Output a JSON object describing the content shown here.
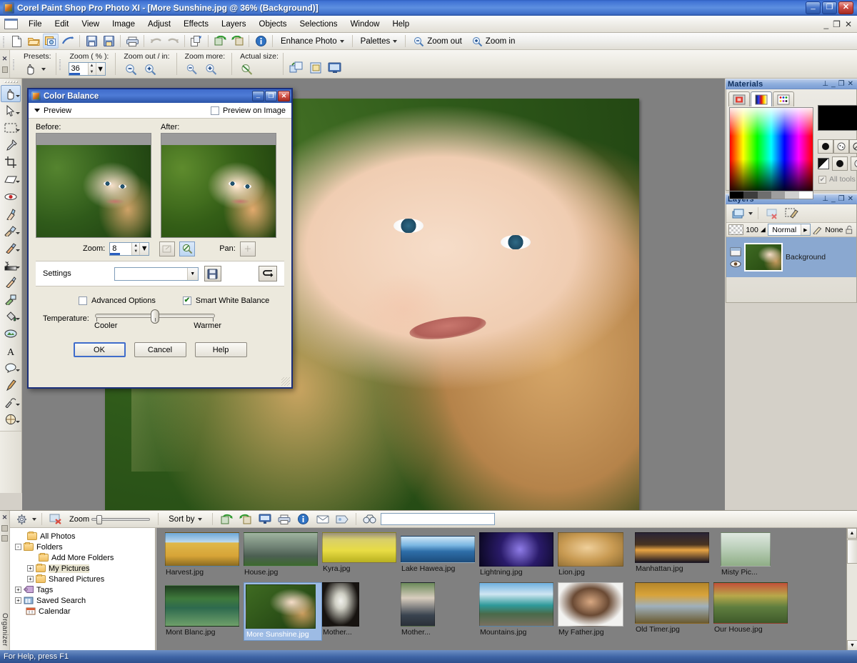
{
  "window": {
    "title": "Corel Paint Shop Pro Photo XI - [More Sunshine.jpg @  36% (Background)]",
    "minimize": "_",
    "restore": "❐",
    "close": "✕",
    "doc_minimize": "_",
    "doc_restore": "❐",
    "doc_close": "✕"
  },
  "menubar": {
    "items": [
      {
        "label": "File"
      },
      {
        "label": "Edit"
      },
      {
        "label": "View"
      },
      {
        "label": "Image"
      },
      {
        "label": "Adjust"
      },
      {
        "label": "Effects"
      },
      {
        "label": "Layers"
      },
      {
        "label": "Objects"
      },
      {
        "label": "Selections"
      },
      {
        "label": "Window"
      },
      {
        "label": "Help"
      }
    ]
  },
  "toolbar": {
    "enhance_photo": "Enhance Photo",
    "palettes": "Palettes",
    "zoom_out": "Zoom out",
    "zoom_in": "Zoom in",
    "icons": [
      "new-icon",
      "open-icon",
      "browse-icon",
      "save-as-shortcut-icon",
      "save-icon",
      "save-copy-icon",
      "print-icon",
      "undo-icon",
      "redo-icon",
      "duplicate-icon",
      "rotate-left-icon",
      "rotate-right-icon",
      "info-icon"
    ]
  },
  "tool_options": {
    "presets_label": "Presets:",
    "zoom_label": "Zoom ( % ):",
    "zoom_value": "36",
    "zoom_outin_label": "Zoom out / in:",
    "zoom_more_label": "Zoom more:",
    "actual_size_label": "Actual size:"
  },
  "tools": {
    "items": [
      {
        "name": "pan-tool",
        "selected": true,
        "arrow": true
      },
      {
        "name": "pick-tool",
        "selected": false,
        "arrow": true
      },
      {
        "name": "selection-tool",
        "selected": false,
        "arrow": true
      },
      {
        "name": "dropper-tool",
        "selected": false,
        "arrow": false
      },
      {
        "name": "crop-tool",
        "selected": false,
        "arrow": false
      },
      {
        "name": "straighten-tool",
        "selected": false,
        "arrow": true
      },
      {
        "name": "red-eye-tool",
        "selected": false,
        "arrow": false
      },
      {
        "name": "makeover-tool",
        "selected": false,
        "arrow": false
      },
      {
        "name": "clone-brush-tool",
        "selected": false,
        "arrow": true
      },
      {
        "name": "scratch-remover-tool",
        "selected": false,
        "arrow": true
      },
      {
        "name": "dodge-burn-tool",
        "selected": false,
        "arrow": true
      },
      {
        "name": "paint-brush-tool",
        "selected": false,
        "arrow": false
      },
      {
        "name": "airbrush-tool",
        "selected": false,
        "arrow": false
      },
      {
        "name": "flood-fill-tool",
        "selected": false,
        "arrow": true
      },
      {
        "name": "picture-tube-tool",
        "selected": false,
        "arrow": false
      },
      {
        "name": "text-tool",
        "selected": false,
        "arrow": false
      },
      {
        "name": "preset-shape-tool",
        "selected": false,
        "arrow": true
      },
      {
        "name": "pen-tool",
        "selected": false,
        "arrow": false
      },
      {
        "name": "warp-brush-tool",
        "selected": false,
        "arrow": true
      },
      {
        "name": "mesh-warp-tool",
        "selected": false,
        "arrow": true
      }
    ]
  },
  "materials": {
    "title": "Materials",
    "pin": "⊥",
    "minimize": "_",
    "maximize": "❐",
    "close": "✕",
    "tabs": [
      "frame-tab",
      "rainbow-tab",
      "swatches-tab"
    ],
    "all_tools_label": "All tools",
    "foreground_color": "#000000",
    "background_color": "#ffffff"
  },
  "layers": {
    "title": "Layers",
    "pin": "⊥",
    "minimize": "_",
    "maximize": "❐",
    "close": "✕",
    "opacity": "100",
    "blend_mode": "Normal",
    "mask_label": "None",
    "rows": [
      {
        "name": "Background"
      }
    ]
  },
  "organizer": {
    "tab_label": "Organizer",
    "zoom_label": "Zoom",
    "sort_by_label": "Sort by",
    "search_value": "",
    "tree": [
      {
        "label": "All Photos",
        "depth": 1,
        "expander": "",
        "icon": "folder-icon",
        "selected": false
      },
      {
        "label": "Folders",
        "depth": 0,
        "expander": "-",
        "icon": "folder-icon",
        "selected": false
      },
      {
        "label": "Add More Folders",
        "depth": 2,
        "expander": "",
        "icon": "add-folder-icon",
        "selected": false
      },
      {
        "label": "My Pictures",
        "depth": 1,
        "expander": "+",
        "icon": "folder-icon",
        "selected": true
      },
      {
        "label": "Shared Pictures",
        "depth": 1,
        "expander": "+",
        "icon": "folder-icon",
        "selected": false
      },
      {
        "label": "Tags",
        "depth": 0,
        "expander": "+",
        "icon": "tag-icon",
        "selected": false
      },
      {
        "label": "Saved Search",
        "depth": 0,
        "expander": "+",
        "icon": "saved-search-icon",
        "selected": false
      },
      {
        "label": "Calendar",
        "depth": 0,
        "expander": "",
        "icon": "calendar-icon",
        "selected": false
      }
    ],
    "thumbnails": [
      {
        "caption": "Harvest.jpg",
        "selected": false
      },
      {
        "caption": "House.jpg",
        "selected": false
      },
      {
        "caption": "Kyra.jpg",
        "selected": false
      },
      {
        "caption": "Lake Hawea.jpg",
        "selected": false
      },
      {
        "caption": "Lightning.jpg",
        "selected": false
      },
      {
        "caption": "Lion.jpg",
        "selected": false
      },
      {
        "caption": "Manhattan.jpg",
        "selected": false
      },
      {
        "caption": "Misty Pic...",
        "selected": false
      },
      {
        "caption": "Mont Blanc.jpg",
        "selected": false
      },
      {
        "caption": "More Sunshine.jpg",
        "selected": true
      },
      {
        "caption": "Mother...",
        "selected": false
      },
      {
        "caption": "Mother...",
        "selected": false
      },
      {
        "caption": "Mountains.jpg",
        "selected": false
      },
      {
        "caption": "My Father.jpg",
        "selected": false
      },
      {
        "caption": "Old Timer.jpg",
        "selected": false
      },
      {
        "caption": "Our House.jpg",
        "selected": false
      }
    ]
  },
  "dialog": {
    "title": "Color Balance",
    "minimize": "_",
    "maximize": "❐",
    "close": "✕",
    "preview_label": "Preview",
    "preview_on_image_label": "Preview on Image",
    "preview_on_image_checked": false,
    "before_label": "Before:",
    "after_label": "After:",
    "zoom_label": "Zoom:",
    "zoom_value": "8",
    "pan_label": "Pan:",
    "settings_label": "Settings",
    "settings_value": "",
    "advanced_options_label": "Advanced Options",
    "advanced_options_checked": false,
    "smart_white_balance_label": "Smart White Balance",
    "smart_white_balance_checked": true,
    "smart_white_balance_check": "✔",
    "temperature_label": "Temperature:",
    "cooler_label": "Cooler",
    "warmer_label": "Warmer",
    "ok_label": "OK",
    "cancel_label": "Cancel",
    "help_label": "Help"
  },
  "statusbar": {
    "text": "For Help, press F1"
  }
}
